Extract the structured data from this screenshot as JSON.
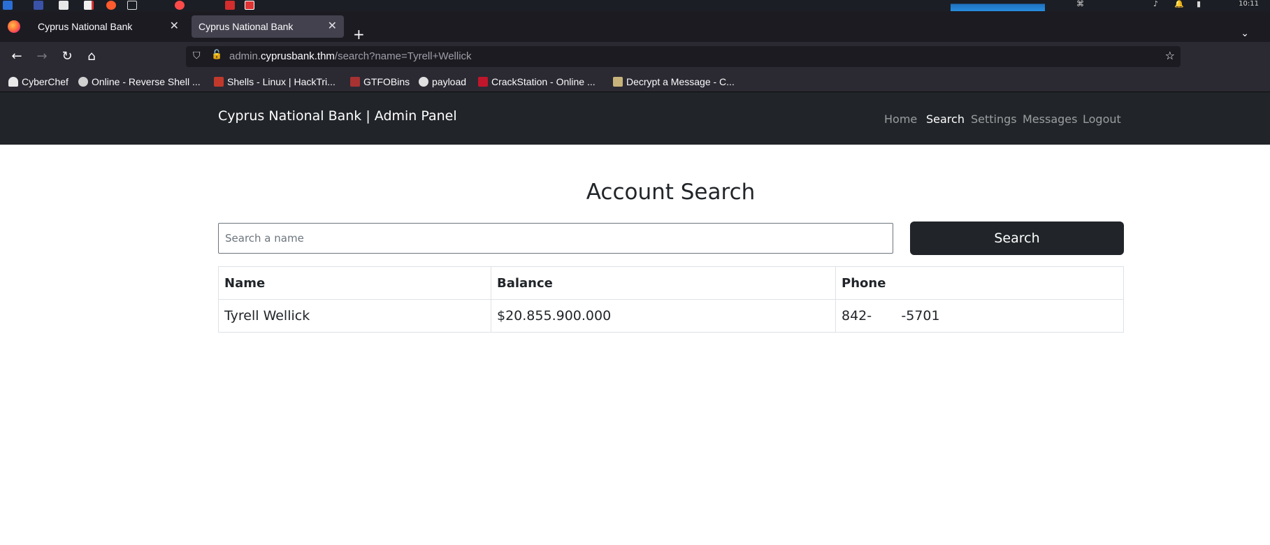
{
  "taskbar": {
    "clock": "10:11"
  },
  "browser": {
    "tabs": [
      {
        "label": "Cyprus National Bank",
        "active": false
      },
      {
        "label": "Cyprus National Bank",
        "active": true
      }
    ],
    "url": {
      "prefix": "admin.",
      "host": "cyprusbank.thm",
      "path": "/search?name=Tyrell+Wellick"
    },
    "bookmarks": [
      {
        "label": "CyberChef",
        "icon": "chef-hat-icon",
        "color": "#e8e8e8"
      },
      {
        "label": "Online - Reverse Shell ...",
        "icon": "skull-icon",
        "color": "#d0d0d0"
      },
      {
        "label": "Shells - Linux | HackTri...",
        "icon": "hacktricks-icon",
        "color": "#c0392b"
      },
      {
        "label": "GTFOBins",
        "icon": "gtfobins-icon",
        "color": "#a83232"
      },
      {
        "label": "payload",
        "icon": "github-icon",
        "color": "#e0e0e0"
      },
      {
        "label": "CrackStation - Online ...",
        "icon": "crackstation-icon",
        "color": "#c0162b"
      },
      {
        "label": "Decrypt a Message - C...",
        "icon": "envelope-icon",
        "color": "#c8b37a"
      }
    ]
  },
  "site": {
    "brand": "Cyprus National Bank | Admin Panel",
    "nav": [
      {
        "label": "Home",
        "active": false
      },
      {
        "label": "Search",
        "active": true
      },
      {
        "label": "Settings",
        "active": false
      },
      {
        "label": "Messages",
        "active": false
      },
      {
        "label": "Logout",
        "active": false
      }
    ]
  },
  "main": {
    "title": "Account Search",
    "search": {
      "placeholder": "Search a name",
      "value": "",
      "button_label": "Search"
    },
    "table": {
      "headers": [
        "Name",
        "Balance",
        "Phone"
      ],
      "rows": [
        [
          "Tyrell Wellick",
          "$20.855.900.000",
          "842-       -5701"
        ]
      ]
    }
  },
  "colors": {
    "navbar_bg": "#212529",
    "button_bg": "#212529",
    "browser_chrome": "#2b2a33",
    "tabstrip": "#1c1b22"
  }
}
